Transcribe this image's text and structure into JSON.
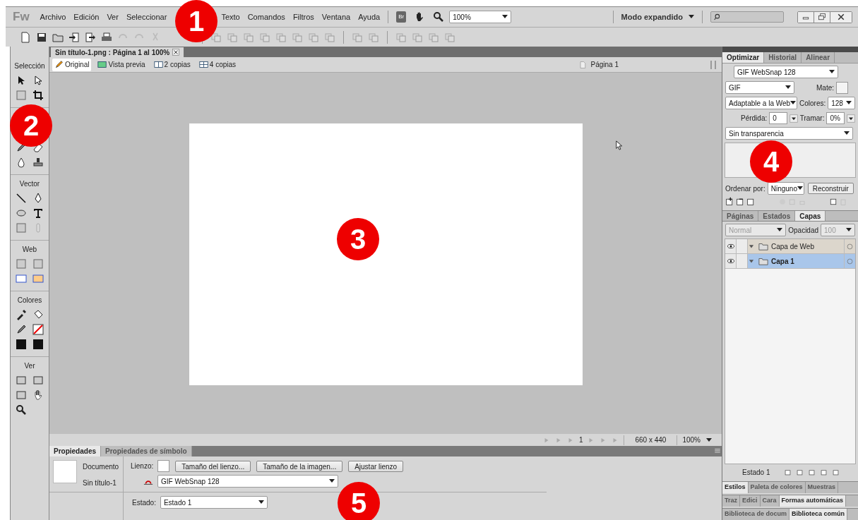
{
  "app": {
    "logo": "Fw",
    "menu": [
      "Archivo",
      "Edición",
      "Ver",
      "Seleccionar",
      "Texto",
      "Comandos",
      "Filtros",
      "Ventana",
      "Ayuda"
    ],
    "bridge": "Br",
    "zoom": "100%",
    "workspace": "Modo expandido"
  },
  "document": {
    "tab": "Sin título-1.png : Página 1 al 100%",
    "views": [
      {
        "label": "Original",
        "selected": true
      },
      {
        "label": "Vista previa",
        "selected": false
      },
      {
        "label": "2 copias",
        "selected": false
      },
      {
        "label": "4 copias",
        "selected": false
      }
    ],
    "page": "Página 1"
  },
  "tools": {
    "sections": [
      "Selección",
      "Vector",
      "Web",
      "Colores",
      "Ver"
    ]
  },
  "status_bar": {
    "frame": "1",
    "size": "660 x 440",
    "zoom": "100%"
  },
  "properties": {
    "tabs": [
      {
        "label": "Propiedades",
        "selected": true
      },
      {
        "label": "Propiedades de símbolo",
        "selected": false
      }
    ],
    "kind": "Documento",
    "name": "Sin título-1",
    "canvas_label": "Lienzo:",
    "buttons": [
      "Tamaño del lienzo...",
      "Tamaño de la imagen...",
      "Ajustar lienzo"
    ],
    "preset": "GIF WebSnap 128",
    "state_label": "Estado:",
    "state": "Estado 1"
  },
  "optimize": {
    "tabs": [
      {
        "label": "Optimizar",
        "selected": true
      },
      {
        "label": "Historial",
        "selected": false
      },
      {
        "label": "Alinear",
        "selected": false
      }
    ],
    "preset": "GIF WebSnap 128",
    "format": "GIF",
    "matte_label": "Mate:",
    "palette": "Adaptable a la Web",
    "colors_label": "Colores:",
    "colors": "128",
    "loss_label": "Pérdida:",
    "loss": "0",
    "dither_label": "Tramar:",
    "dither": "0%",
    "transparency": "Sin transparencia",
    "sort_label": "Ordenar por:",
    "sort": "Ninguno",
    "rebuild": "Reconstruir"
  },
  "layers": {
    "tabs": [
      {
        "label": "Páginas",
        "selected": false
      },
      {
        "label": "Estados",
        "selected": false
      },
      {
        "label": "Capas",
        "selected": true
      }
    ],
    "blend": {
      "value": "Normal",
      "disabled": true
    },
    "opacity_label": "Opacidad",
    "opacity": {
      "value": "100",
      "disabled": true
    },
    "items": [
      {
        "name": "Capa de Web",
        "selected": false
      },
      {
        "name": "Capa 1",
        "selected": true
      }
    ],
    "state": "Estado 1"
  },
  "panel_groups": [
    [
      {
        "label": "Estilos",
        "selected": true
      },
      {
        "label": "Paleta de colores",
        "selected": false
      },
      {
        "label": "Muestras",
        "selected": false
      }
    ],
    [
      {
        "label": "Traz",
        "selected": false
      },
      {
        "label": "Edici",
        "selected": false
      },
      {
        "label": "Cara",
        "selected": false
      },
      {
        "label": "Formas automáticas",
        "selected": true
      }
    ],
    [
      {
        "label": "Biblioteca de docum",
        "selected": false
      },
      {
        "label": "Biblioteca común",
        "selected": true
      }
    ]
  ],
  "callouts": [
    "1",
    "2",
    "3",
    "4",
    "5"
  ]
}
